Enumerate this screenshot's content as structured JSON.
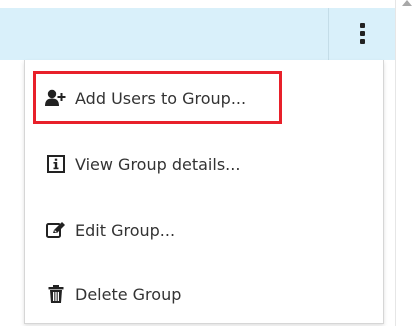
{
  "menu": {
    "items": [
      {
        "label": "Add Users to Group...",
        "icon": "add-user-icon"
      },
      {
        "label": "View Group details...",
        "icon": "info-icon"
      },
      {
        "label": "Edit Group...",
        "icon": "edit-icon"
      },
      {
        "label": "Delete Group",
        "icon": "trash-icon"
      }
    ]
  },
  "colors": {
    "header_background": "#d9f0fa",
    "highlight": "#e8202a",
    "text": "#333333"
  }
}
